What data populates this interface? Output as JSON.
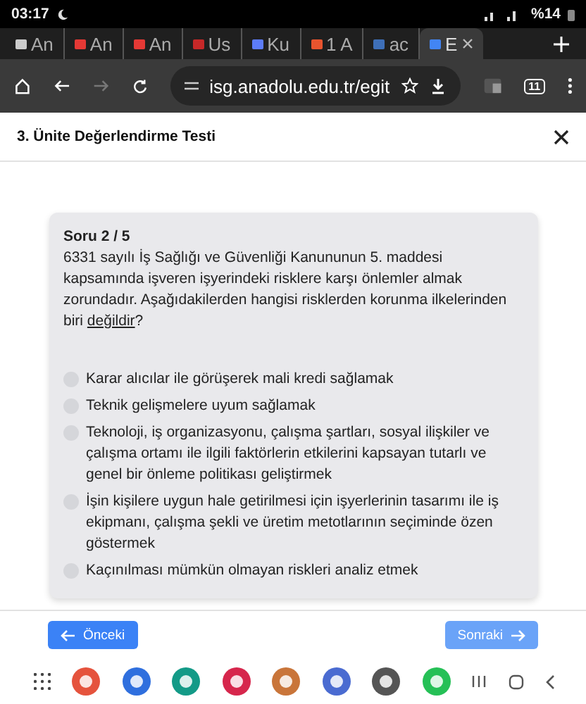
{
  "status_bar": {
    "time": "03:17",
    "battery": "%14"
  },
  "browser_tabs": [
    {
      "label": "An",
      "selected": false
    },
    {
      "label": "An",
      "selected": false
    },
    {
      "label": "An",
      "selected": false
    },
    {
      "label": "Us",
      "selected": false
    },
    {
      "label": "Ku",
      "selected": false
    },
    {
      "label": "1 A",
      "selected": false
    },
    {
      "label": "ac",
      "selected": false
    },
    {
      "label": "E",
      "selected": true
    }
  ],
  "address_bar": {
    "url": "isg.anadolu.edu.tr/egit",
    "tab_count": "11"
  },
  "dialog": {
    "title": "3. Ünite Değerlendirme Testi"
  },
  "question": {
    "counter": "Soru 2 / 5",
    "text": "6331 sayılı İş Sağlığı ve Güvenliği Kanununun 5. maddesi kapsamında işveren işyerindeki risklere karşı önlemler almak zorundadır. Aşağıdakilerden hangisi risklerden korunma ilkelerinden biri ",
    "underlined": "değildir",
    "after": "?"
  },
  "options": [
    {
      "label": "Karar alıcılar ile görüşerek mali kredi sağlamak",
      "selected": false
    },
    {
      "label": "Teknik gelişmelere uyum sağlamak",
      "selected": false
    },
    {
      "label": "Teknoloji, iş organizasyonu, çalışma şartları, sosyal ilişkiler ve çalışma ortamı ile ilgili faktörlerin etkilerini kapsayan tutarlı ve genel bir önleme politikası geliştirmek",
      "selected": false
    },
    {
      "label": "İşin kişilere uygun hale getirilmesi için işyerlerinin tasarımı ile iş ekipmanı, çalışma şekli ve üretim metotlarının seçiminde özen göstermek",
      "selected": false
    },
    {
      "label": "Kaçınılması mümkün olmayan riskleri analiz etmek",
      "selected": false
    }
  ],
  "footer": {
    "previous": "Önceki",
    "next": "Sonraki"
  }
}
